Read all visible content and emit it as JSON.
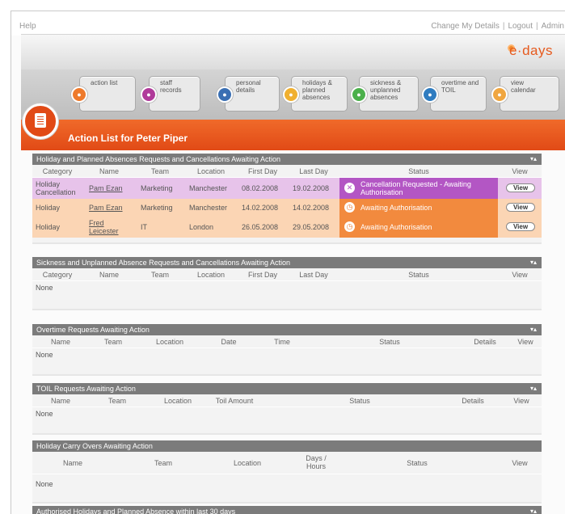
{
  "top": {
    "help": "Help",
    "change_details": "Change My Details",
    "logout": "Logout",
    "admin": "Admin",
    "sep": "|"
  },
  "logo": "e·days",
  "nav": [
    {
      "label": "action list",
      "color": "#ee7a2c",
      "icon": "lock-icon"
    },
    {
      "label": "staff records",
      "color": "#b03a9a",
      "icon": "people-icon"
    },
    {
      "label": "personal details",
      "color": "#3a6fb3",
      "icon": "person-icon"
    },
    {
      "label": "holidays & planned absences",
      "color": "#f0b030",
      "icon": "sun-icon"
    },
    {
      "label": "sickness & unplanned absences",
      "color": "#4bb04b",
      "icon": "cross-icon"
    },
    {
      "label": "overtime and TOIL",
      "color": "#2f7cc0",
      "icon": "clock-icon"
    },
    {
      "label": "view calendar",
      "color": "#f0a640",
      "icon": "calendar-icon"
    }
  ],
  "page_title": "Action List for Peter Piper",
  "toggle": "▾▴",
  "holiday_panel": {
    "title": "Holiday and Planned Absences Requests and Cancellations Awaiting Action",
    "columns": [
      "Category",
      "Name",
      "Team",
      "Location",
      "First Day",
      "Last Day",
      "Status",
      "View"
    ],
    "rows": [
      {
        "category": "Holiday Cancellation",
        "name": "Pam Ezan",
        "team": "Marketing",
        "location": "Manchester",
        "first": "08.02.2008",
        "last": "19.02.2008",
        "status": "Cancellation Requested - Awaiting Authorisation",
        "row_bg": "#e7c3ea",
        "status_bg": "#b356c4",
        "view": "View"
      },
      {
        "category": "Holiday",
        "name": "Pam Ezan",
        "team": "Marketing",
        "location": "Manchester",
        "first": "14.02.2008",
        "last": "14.02.2008",
        "status": "Awaiting Authorisation",
        "row_bg": "#fbd5b4",
        "status_bg": "#f28a3e",
        "view": "View"
      },
      {
        "category": "Holiday",
        "name": "Fred Leicester",
        "team": "IT",
        "location": "London",
        "first": "26.05.2008",
        "last": "29.05.2008",
        "status": "Awaiting Authorisation",
        "row_bg": "#fbd5b4",
        "status_bg": "#f28a3e",
        "view": "View"
      }
    ]
  },
  "sickness_panel": {
    "title": "Sickness and Unplanned Absence Requests and Cancellations Awaiting Action",
    "columns": [
      "Category",
      "Name",
      "Team",
      "Location",
      "First Day",
      "Last Day",
      "Status",
      "View"
    ],
    "empty": "None"
  },
  "overtime_panel": {
    "title": "Overtime Requests Awaiting Action",
    "columns": [
      "Name",
      "Team",
      "Location",
      "Date",
      "Time",
      "Status",
      "Details",
      "View"
    ],
    "empty": "None"
  },
  "toil_panel": {
    "title": "TOIL Requests Awaiting Action",
    "columns": [
      "Name",
      "Team",
      "Location",
      "Toil Amount",
      "Status",
      "Details",
      "View"
    ],
    "empty": "None"
  },
  "carry_panel": {
    "title": "Holiday Carry Overs Awaiting Action",
    "columns": [
      "Name",
      "Team",
      "Location",
      "Days / Hours",
      "Status",
      "View"
    ],
    "empty": "None"
  },
  "authorised_panel": {
    "title": "Authorised Holidays and Planned Absence within last 30 days"
  }
}
